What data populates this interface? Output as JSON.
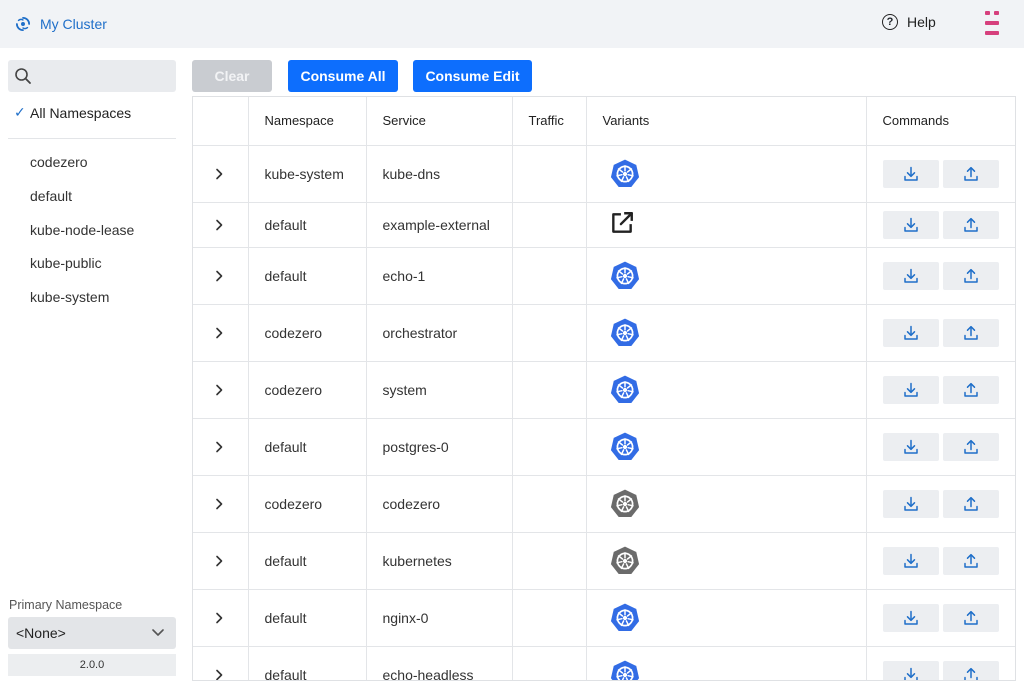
{
  "header": {
    "title": "My Cluster",
    "brand_icon": "cluster-swirl-icon",
    "help_glyph": "?",
    "help_label": "Help",
    "menu_icon": "menu-bars-icon",
    "accent_color": "#1f6fc9",
    "menu_color": "#d6407d"
  },
  "sidebar": {
    "search": {
      "placeholder": "",
      "value": ""
    },
    "all_namespaces_check": "✓",
    "all_namespaces_label": "All Namespaces",
    "namespaces": [
      {
        "label": "codezero"
      },
      {
        "label": "default"
      },
      {
        "label": "kube-node-lease"
      },
      {
        "label": "kube-public"
      },
      {
        "label": "kube-system"
      }
    ],
    "primary_namespace_label": "Primary Namespace",
    "primary_namespace_value": "<None>",
    "version": "2.0.0"
  },
  "toolbar": {
    "clear_label": "Clear",
    "consume_all_label": "Consume All",
    "consume_edit_label": "Consume Edit",
    "button_color": "#0d6efd"
  },
  "table": {
    "headers": {
      "expand": "",
      "namespace": "Namespace",
      "service": "Service",
      "traffic": "Traffic",
      "variants": "Variants",
      "commands": "Commands"
    },
    "rows": [
      {
        "namespace": "kube-system",
        "service": "kube-dns",
        "traffic": "",
        "variant": "kubernetes-active",
        "variant_color": "#326ce5"
      },
      {
        "namespace": "default",
        "service": "example-external",
        "traffic": "",
        "variant": "external-link",
        "variant_color": "#222222"
      },
      {
        "namespace": "default",
        "service": "echo-1",
        "traffic": "",
        "variant": "kubernetes-active",
        "variant_color": "#326ce5"
      },
      {
        "namespace": "codezero",
        "service": "orchestrator",
        "traffic": "",
        "variant": "kubernetes-active",
        "variant_color": "#326ce5"
      },
      {
        "namespace": "codezero",
        "service": "system",
        "traffic": "",
        "variant": "kubernetes-active",
        "variant_color": "#326ce5"
      },
      {
        "namespace": "default",
        "service": "postgres-0",
        "traffic": "",
        "variant": "kubernetes-active",
        "variant_color": "#326ce5"
      },
      {
        "namespace": "codezero",
        "service": "codezero",
        "traffic": "",
        "variant": "kubernetes-inactive",
        "variant_color": "#6b6b6b"
      },
      {
        "namespace": "default",
        "service": "kubernetes",
        "traffic": "",
        "variant": "kubernetes-inactive",
        "variant_color": "#6b6b6b"
      },
      {
        "namespace": "default",
        "service": "nginx-0",
        "traffic": "",
        "variant": "kubernetes-active",
        "variant_color": "#326ce5"
      },
      {
        "namespace": "default",
        "service": "echo-headless",
        "traffic": "",
        "variant": "kubernetes-active",
        "variant_color": "#326ce5"
      }
    ],
    "command_icons": [
      "download-icon",
      "upload-icon"
    ],
    "command_color": "#1f6fc9"
  }
}
